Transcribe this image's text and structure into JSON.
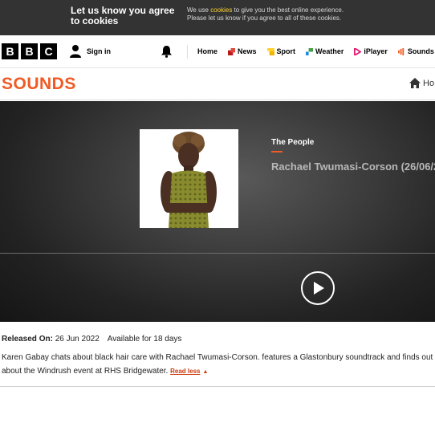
{
  "cookie": {
    "title": "Let us know you agree to cookies",
    "text_pre": "We use ",
    "link": "cookies",
    "text_post": " to give you the best online experience.",
    "line2": "Please let us know if you agree to all of these cookies."
  },
  "nav": {
    "logo_letters": [
      "B",
      "B",
      "C"
    ],
    "sign_in": "Sign in",
    "items": [
      {
        "label": "Home",
        "icon": "none"
      },
      {
        "label": "News",
        "icon": "news-icon",
        "color": "#bb1919"
      },
      {
        "label": "Sport",
        "icon": "sport-icon",
        "color": "#ffd230"
      },
      {
        "label": "Weather",
        "icon": "weather-icon",
        "color": "#1e88e5"
      },
      {
        "label": "iPlayer",
        "icon": "iplayer-icon",
        "color": "#e01a73"
      },
      {
        "label": "Sounds",
        "icon": "sounds-icon",
        "color": "#f05a24"
      }
    ]
  },
  "sounds": {
    "logo": "SOUNDS",
    "home_link": "Ho"
  },
  "episode": {
    "show_title": "The People",
    "title": "Rachael Twumasi-Corson (26/06/2",
    "released_label": "Released On:",
    "released_date": " 26 Jun 2022",
    "availability": "Available for 18 days",
    "description_line1": "Karen Gabay chats about black hair care with Rachael Twumasi-Corson. features a Glastonbury soundtrack and finds out more",
    "description_line2": "about the Windrush event at RHS Bridgewater. ",
    "read_less": "Read less"
  },
  "colors": {
    "brand_orange": "#f05a24",
    "cookie_bg": "#333333",
    "cookie_link": "#ffd230"
  }
}
